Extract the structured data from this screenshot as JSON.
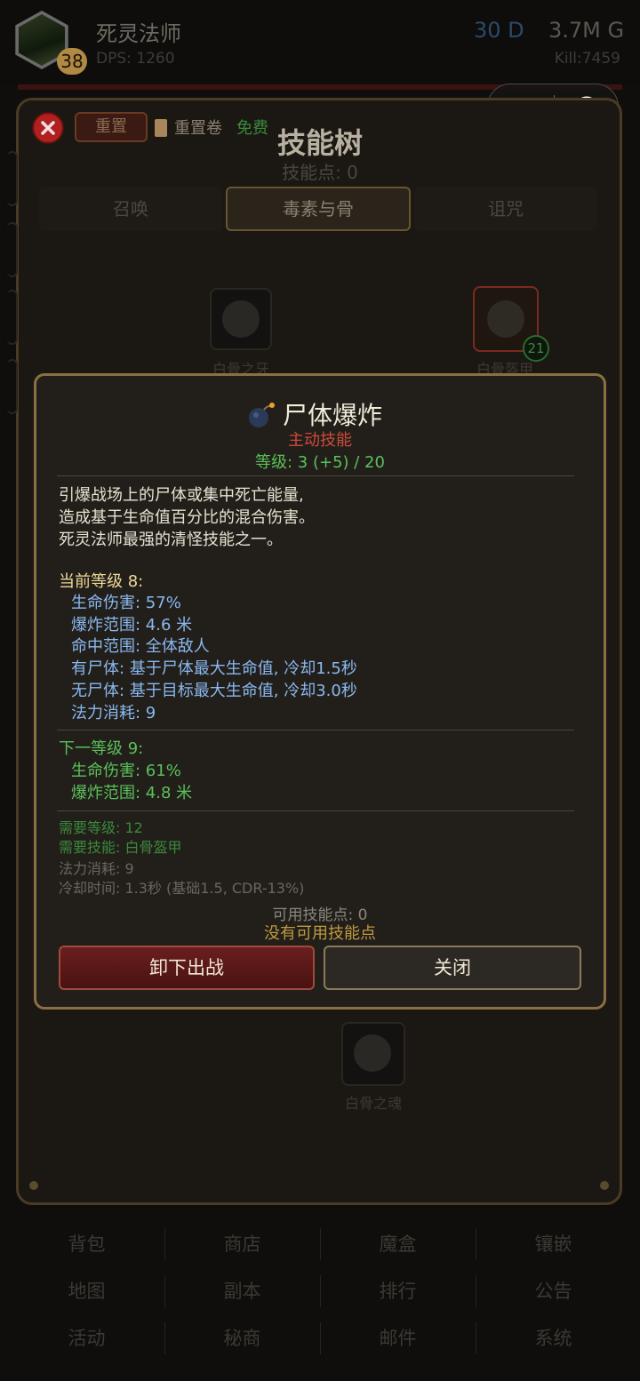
{
  "header": {
    "hero_name": "死灵法师",
    "hero_level": "38",
    "dps": "DPS: 1260",
    "diamonds": "30 D",
    "gold": "3.7M G",
    "kills": "Kill:7459"
  },
  "skill_tree": {
    "reset_label": "重置",
    "reset_scroll_label": "重置卷",
    "reset_cost": "免费",
    "title": "技能树",
    "skill_points": "技能点: 0",
    "tabs": [
      {
        "label": "召唤",
        "active": false
      },
      {
        "label": "毒素与骨",
        "active": true
      },
      {
        "label": "诅咒",
        "active": false
      }
    ],
    "nodes": {
      "bone_fang": {
        "label": "白骨之牙"
      },
      "bone_armor": {
        "label": "白骨盔甲",
        "count": "21"
      },
      "bone_soul": {
        "label": "白骨之魂"
      }
    }
  },
  "tooltip": {
    "icon": "bomb-icon",
    "name": "尸体爆炸",
    "type": "主动技能",
    "level": "等级: 3 (+5) / 20",
    "description": [
      "引爆战场上的尸体或集中死亡能量,",
      "造成基于生命值百分比的混合伤害。",
      "死灵法师最强的清怪技能之一。"
    ],
    "current": {
      "header": "当前等级 8:",
      "stats": [
        "生命伤害: 57%",
        "爆炸范围: 4.6 米",
        "命中范围: 全体敌人",
        "有尸体: 基于尸体最大生命值, 冷却1.5秒",
        "无尸体: 基于目标最大生命值, 冷却3.0秒",
        "法力消耗: 9"
      ]
    },
    "next": {
      "header": "下一等级 9:",
      "stats": [
        "生命伤害: 61%",
        "爆炸范围: 4.8 米"
      ]
    },
    "requirements": {
      "level": "需要等级: 12",
      "skill": "需要技能: 白骨盔甲",
      "mana": "法力消耗: 9",
      "cooldown": "冷却时间: 1.3秒 (基础1.5, CDR-13%)"
    },
    "available_points": "可用技能点: 0",
    "no_points": "没有可用技能点",
    "unequip_button": "卸下出战",
    "close_button": "关闭"
  },
  "bottom_menu": [
    [
      "背包",
      "商店",
      "魔盒",
      "镶嵌"
    ],
    [
      "地图",
      "副本",
      "排行",
      "公告"
    ],
    [
      "活动",
      "秘商",
      "邮件",
      "系统"
    ]
  ],
  "colors": {
    "accent_gold": "#8a7040",
    "active_red": "#d04a3a",
    "level_green": "#5ac05a",
    "stat_blue": "#8ab8f0"
  }
}
